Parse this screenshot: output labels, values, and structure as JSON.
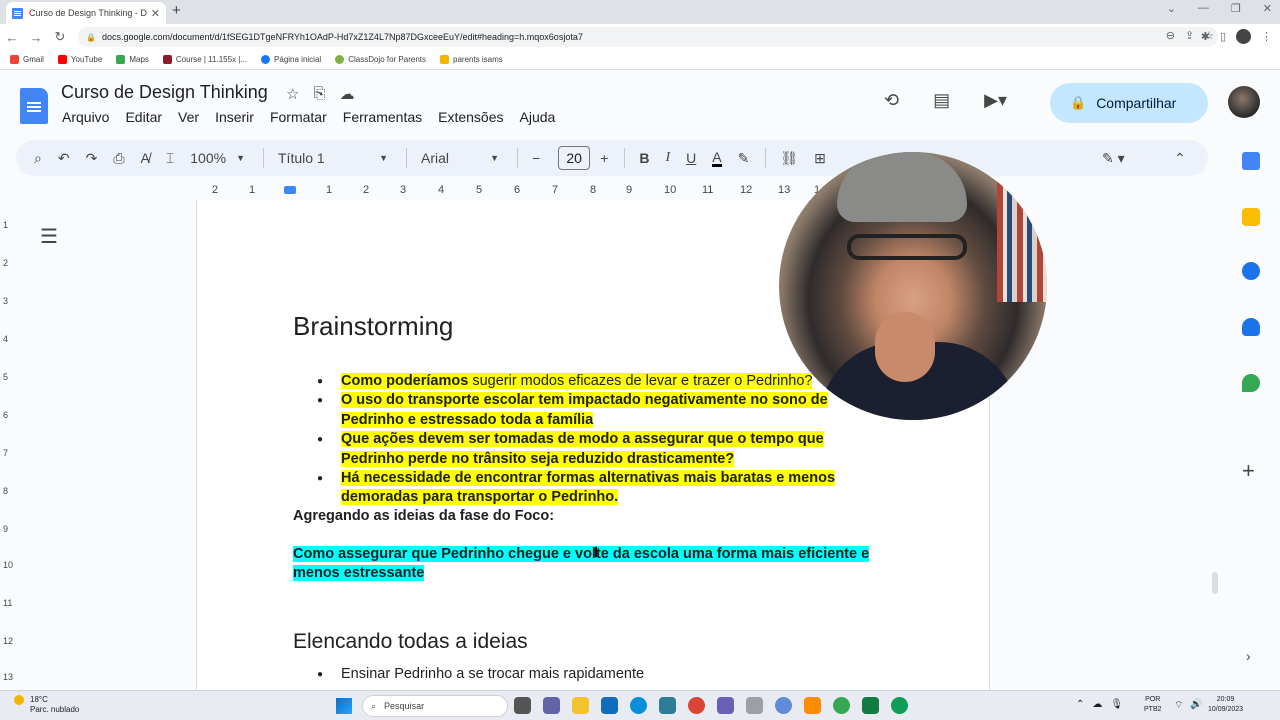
{
  "browser": {
    "tab_title": "Curso de Design Thinking - Doc",
    "url": "docs.google.com/document/d/1fSEG1DTgeNFRYh1OAdP-Hd7xZ1Z4L7Np87DGxceeEuY/edit#heading=h.mqox6osjota7",
    "bookmarks": [
      "Gmail",
      "YouTube",
      "Maps",
      "Course | 11.155x |...",
      "Página inicial",
      "ClassDojo for Parents",
      "parents isams"
    ]
  },
  "docs": {
    "title": "Curso de Design Thinking",
    "menu": [
      "Arquivo",
      "Editar",
      "Ver",
      "Inserir",
      "Formatar",
      "Ferramentas",
      "Extensões",
      "Ajuda"
    ],
    "share_label": "Compartilhar"
  },
  "toolbar": {
    "zoom": "100%",
    "style": "Título 1",
    "font": "Arial",
    "font_size": "20"
  },
  "ruler": [
    "2",
    "1",
    "1",
    "2",
    "3",
    "4",
    "5",
    "6",
    "7",
    "8",
    "9",
    "10",
    "11",
    "12",
    "13",
    "1"
  ],
  "vruler": [
    "1",
    "2",
    "3",
    "4",
    "5",
    "6",
    "7",
    "8",
    "9",
    "10",
    "11",
    "12",
    "13"
  ],
  "document": {
    "heading1": "Brainstorming",
    "bullets": [
      {
        "bold": "Como poderíamos",
        "normal": " sugerir modos eficazes de levar e trazer o Pedrinho?"
      },
      {
        "bold": "O uso do transporte escolar tem impactado negativamente no sono de Pedrinho e estressado toda a família",
        "normal": ""
      },
      {
        "bold": "Que ações devem ser tomadas de modo a assegurar que o tempo que Pedrinho perde no trânsito seja reduzido drasticamente?",
        "normal": ""
      },
      {
        "bold": "Há necessidade de encontrar formas alternativas mais baratas e menos demoradas para transportar o Pedrinho.",
        "normal": ""
      }
    ],
    "aggregate_label": "Agregando as ideias da fase do Foco:",
    "focus_sentence": "Como assegurar que Pedrinho chegue e volte da escola uma forma mais eficiente e menos estressante",
    "heading2": "Elencando todas a ideias",
    "ideas": [
      "Ensinar Pedrinho a se trocar mais rapidamente"
    ]
  },
  "taskbar": {
    "temperature": "18°C",
    "weather": "Parc. nublado",
    "search_placeholder": "Pesquisar",
    "lang_top": "POR",
    "lang_bottom": "PTB2",
    "time": "20:09",
    "date": "10/09/2023"
  },
  "colors": {
    "highlight_yellow": "#ffff00",
    "highlight_cyan": "#00ffff",
    "share_bg": "#c2e7ff",
    "docs_blue": "#4285f4"
  }
}
